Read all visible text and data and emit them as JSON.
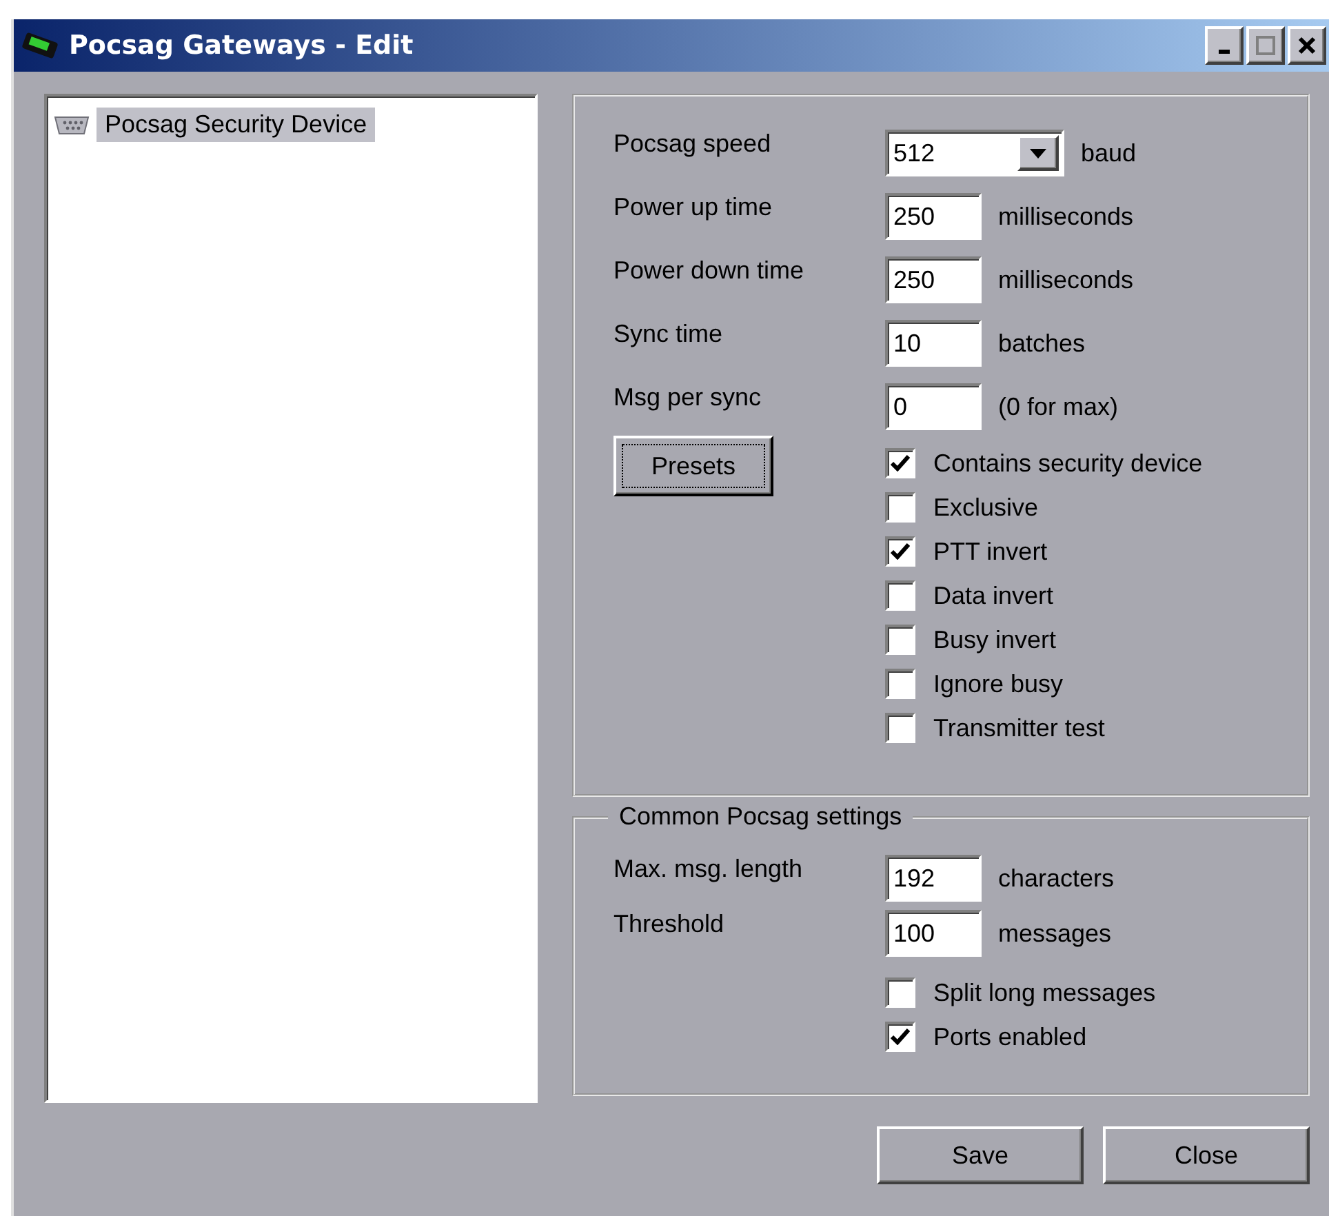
{
  "window": {
    "title": "Pocsag Gateways - Edit"
  },
  "tree": {
    "items": [
      {
        "label": "Pocsag Security Device",
        "selected": true
      }
    ]
  },
  "device_settings": {
    "fields": [
      {
        "label": "Pocsag speed",
        "kind": "dropdown",
        "value": "512",
        "unit": "baud"
      },
      {
        "label": "Power up time",
        "kind": "text",
        "value": "250",
        "unit": "milliseconds"
      },
      {
        "label": "Power down time",
        "kind": "text",
        "value": "250",
        "unit": "milliseconds"
      },
      {
        "label": "Sync time",
        "kind": "text",
        "value": "10",
        "unit": "batches"
      },
      {
        "label": "Msg per sync",
        "kind": "text",
        "value": "0",
        "unit": "(0 for max)"
      }
    ],
    "presets_button": "Presets",
    "options": [
      {
        "label": "Contains security device",
        "checked": true
      },
      {
        "label": "Exclusive",
        "checked": false
      },
      {
        "label": "PTT invert",
        "checked": true
      },
      {
        "label": "Data invert",
        "checked": false
      },
      {
        "label": "Busy invert",
        "checked": false
      },
      {
        "label": "Ignore busy",
        "checked": false
      },
      {
        "label": "Transmitter test",
        "checked": false
      }
    ]
  },
  "common_settings": {
    "title": "Common Pocsag settings",
    "fields": [
      {
        "label": "Max. msg. length",
        "kind": "text",
        "value": "192",
        "unit": "characters"
      },
      {
        "label": "Threshold",
        "kind": "text",
        "value": "100",
        "unit": "messages"
      }
    ],
    "options": [
      {
        "label": "Split long messages",
        "checked": false
      },
      {
        "label": "Ports enabled",
        "checked": true
      }
    ]
  },
  "buttons": [
    {
      "label": "Save"
    },
    {
      "label": "Close"
    }
  ]
}
